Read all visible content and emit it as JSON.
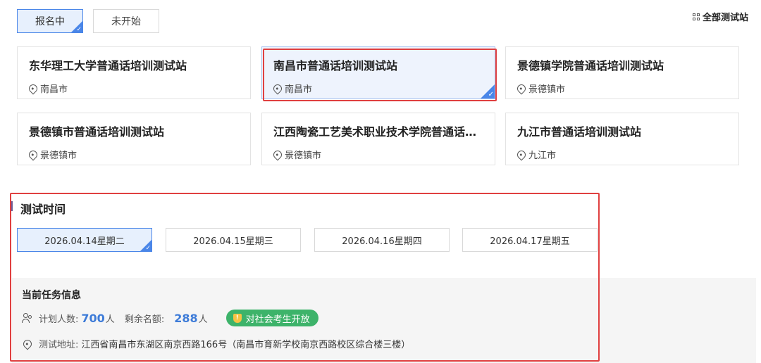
{
  "tabs": [
    {
      "label": "报名中",
      "active": true
    },
    {
      "label": "未开始",
      "active": false
    }
  ],
  "all_stations": {
    "label": "全部测试站"
  },
  "stations": [
    {
      "name": "东华理工大学普通话培训测试站",
      "city": "南昌市",
      "selected": false
    },
    {
      "name": "南昌市普通话培训测试站",
      "city": "南昌市",
      "selected": true
    },
    {
      "name": "景德镇学院普通话培训测试站",
      "city": "景德镇市",
      "selected": false
    },
    {
      "name": "景德镇市普通话培训测试站",
      "city": "景德镇市",
      "selected": false
    },
    {
      "name": "江西陶瓷工艺美术职业技术学院普通话培训测试站",
      "city": "景德镇市",
      "selected": false
    },
    {
      "name": "九江市普通话培训测试站",
      "city": "九江市",
      "selected": false
    }
  ],
  "test_time": {
    "title": "测试时间",
    "dates": [
      {
        "label": "2026.04.14星期二",
        "active": true
      },
      {
        "label": "2026.04.15星期三",
        "active": false
      },
      {
        "label": "2026.04.16星期四",
        "active": false
      },
      {
        "label": "2026.04.17星期五",
        "active": false
      }
    ]
  },
  "task_info": {
    "title": "当前任务信息",
    "planned_label": "计划人数:",
    "planned_value": "700",
    "remaining_label": "剩余名额:",
    "remaining_value": "288",
    "unit": "人",
    "badge": "对社会考生开放",
    "address_label": "测试地址:",
    "address": "江西省南昌市东湖区南京西路166号（南昌市育新学校南京西路校区综合楼三楼）"
  },
  "colors": {
    "accent": "#4a86e8",
    "highlight": "#e04040",
    "badge": "#3db36a",
    "number": "#3d7bd8"
  }
}
